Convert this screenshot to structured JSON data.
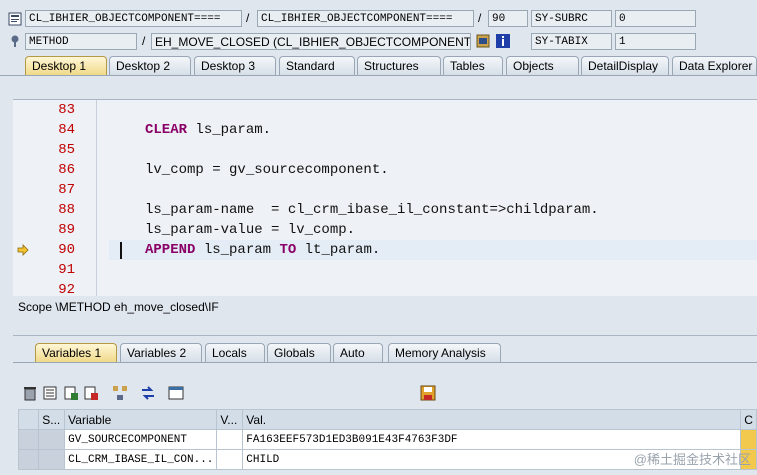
{
  "info_row1": {
    "field1": "CL_IBHIER_OBJECTCOMPONENT====",
    "sep1": "/",
    "field2": "CL_IBHIER_OBJECTCOMPONENT====",
    "sep2": "/",
    "line_no": "90",
    "sysvar_name": "SY-SUBRC",
    "sysvar_value": "0"
  },
  "info_row2": {
    "type": "METHOD",
    "sep": "/",
    "method": "EH_MOVE_CLOSED (CL_IBHIER_OBJECTCOMPONENT)",
    "sysvar_name": "SY-TABIX",
    "sysvar_value": "1"
  },
  "desktop_tabs": [
    "Desktop 1",
    "Desktop 2",
    "Desktop 3",
    "Standard",
    "Structures",
    "Tables",
    "Objects",
    "DetailDisplay",
    "Data Explorer"
  ],
  "editor": {
    "line_numbers": [
      "83",
      "84",
      "85",
      "86",
      "87",
      "88",
      "89",
      "90",
      "91",
      "92"
    ],
    "lines": [
      {
        "kw1": "",
        "rest": ""
      },
      {
        "kw1": "CLEAR",
        "rest": " ls_param."
      },
      {
        "kw1": "",
        "rest": ""
      },
      {
        "kw1": "",
        "rest": "lv_comp = gv_sourcecomponent."
      },
      {
        "kw1": "",
        "rest": ""
      },
      {
        "kw1": "",
        "rest": "ls_param-name  = cl_crm_ibase_il_constant=>childparam."
      },
      {
        "kw1": "",
        "rest": "ls_param-value = lv_comp."
      },
      {
        "kw1": "APPEND",
        "rest": " ls_param ",
        "kw2": "TO",
        "rest2": " lt_param."
      },
      {
        "kw1": "",
        "rest": ""
      },
      {
        "kw1": "",
        "rest": ""
      }
    ],
    "current_line": "90"
  },
  "scope_text": "Scope \\METHOD eh_move_closed\\IF",
  "variable_tabs": [
    "Variables 1",
    "Variables 2",
    "Locals",
    "Globals",
    "Auto",
    "Memory Analysis"
  ],
  "grid": {
    "headers": [
      "S...",
      "Variable",
      "V...",
      "Val.",
      "C"
    ],
    "rows": [
      {
        "variable": "GV_SOURCECOMPONENT",
        "value": "FA163EEF573D1ED3B091E43F4763F3DF"
      },
      {
        "variable": "CL_CRM_IBASE_IL_CON...",
        "value": "CHILD"
      }
    ]
  },
  "watermark": "@稀土掘金技术社区",
  "colors": {
    "active_tab": "#f0d98a",
    "keyword": "#8a0066",
    "line_number": "#c00000"
  }
}
